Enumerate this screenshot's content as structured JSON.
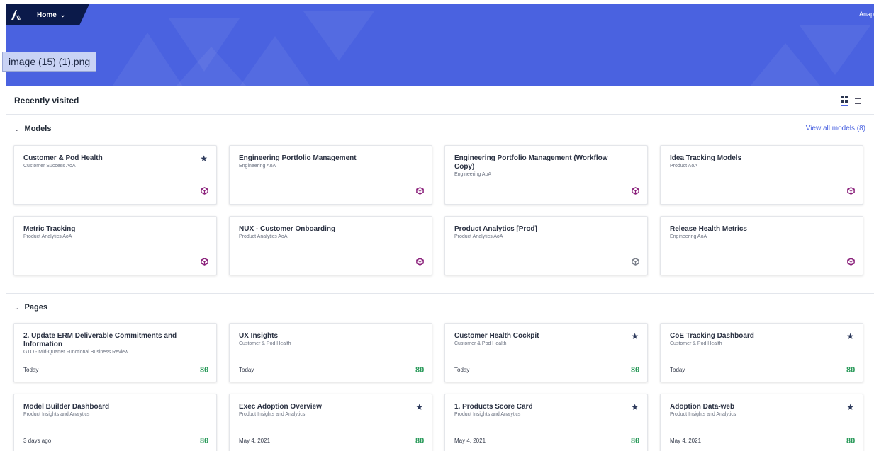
{
  "header": {
    "home_label": "Home",
    "top_right_text": "Anap",
    "file_label": "image (15) (1).png",
    "colors": {
      "banner": "#4a62e0",
      "nav": "#0b1a4a"
    }
  },
  "recently_visited": {
    "title": "Recently visited"
  },
  "models": {
    "heading": "Models",
    "view_all": "View all models (8)",
    "items": [
      {
        "title": "Customer & Pod Health",
        "subtitle": "Customer Success AoA",
        "starred": true,
        "icon": "model-cube-icon"
      },
      {
        "title": "Engineering Portfolio Management",
        "subtitle": "Engineering AoA",
        "starred": false,
        "icon": "model-cube-icon"
      },
      {
        "title": "Engineering Portfolio Management (Workflow Copy)",
        "subtitle": "Engineering AoA",
        "starred": false,
        "icon": "model-cube-icon"
      },
      {
        "title": "Idea Tracking Models",
        "subtitle": "Product AoA",
        "starred": false,
        "icon": "model-cube-icon"
      },
      {
        "title": "Metric Tracking",
        "subtitle": "Product Analytics AoA",
        "starred": false,
        "icon": "model-cube-icon"
      },
      {
        "title": "NUX - Customer Onboarding",
        "subtitle": "Product Analytics AoA",
        "starred": false,
        "icon": "model-cube-icon"
      },
      {
        "title": "Product Analytics [Prod]",
        "subtitle": "Product Analytics AoA",
        "starred": false,
        "icon": "model-cube-gray-icon"
      },
      {
        "title": "Release Health Metrics",
        "subtitle": "Engineering AoA",
        "starred": false,
        "icon": "model-cube-icon"
      }
    ]
  },
  "pages": {
    "heading": "Pages",
    "items": [
      {
        "title": "2. Update ERM Deliverable Commitments and Information",
        "subtitle": "GTO - Mid-Quarter Functional Business Review",
        "date": "Today",
        "starred": false,
        "icon_text": "80"
      },
      {
        "title": "UX Insights",
        "subtitle": "Customer & Pod Health",
        "date": "Today",
        "starred": false,
        "icon_text": "80"
      },
      {
        "title": "Customer Health Cockpit",
        "subtitle": "Customer & Pod Health",
        "date": "Today",
        "starred": true,
        "icon_text": "80"
      },
      {
        "title": "CoE Tracking Dashboard",
        "subtitle": "Customer & Pod Health",
        "date": "Today",
        "starred": true,
        "icon_text": "80"
      },
      {
        "title": "Model Builder Dashboard",
        "subtitle": "Product Insights and Analytics",
        "date": "3 days ago",
        "starred": false,
        "icon_text": "80"
      },
      {
        "title": "Exec Adoption Overview",
        "subtitle": "Product Insights and Analytics",
        "date": "May 4, 2021",
        "starred": true,
        "icon_text": "80"
      },
      {
        "title": "1. Products Score Card",
        "subtitle": "Product Insights and Analytics",
        "date": "May 4, 2021",
        "starred": true,
        "icon_text": "80"
      },
      {
        "title": "Adoption Data-web",
        "subtitle": "Product Insights and Analytics",
        "date": "May 4, 2021",
        "starred": true,
        "icon_text": "80"
      }
    ]
  }
}
